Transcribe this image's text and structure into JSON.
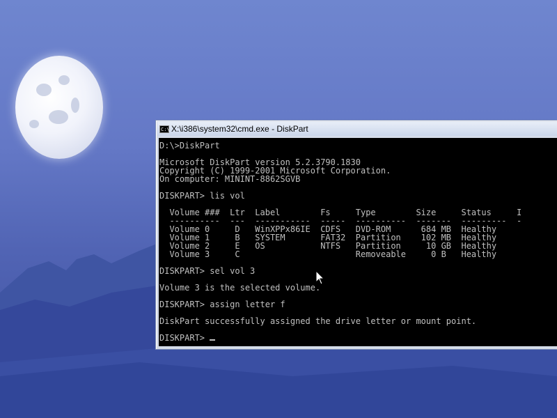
{
  "window": {
    "title": "X:\\i386\\system32\\cmd.exe - DiskPart",
    "icon": "cmd-icon"
  },
  "console": {
    "lines": [
      "D:\\>DiskPart",
      "",
      "Microsoft DiskPart version 5.2.3790.1830",
      "Copyright (C) 1999-2001 Microsoft Corporation.",
      "On computer: MININT-8862SGVB",
      "",
      "DISKPART> lis vol",
      "",
      "  Volume ###  Ltr  Label        Fs     Type        Size     Status     I",
      "  ----------  ---  -----------  -----  ----------  -------  ---------  -",
      "  Volume 0     D   WinXPPx86IE  CDFS   DVD-ROM      684 MB  Healthy",
      "  Volume 1     B   SYSTEM       FAT32  Partition    102 MB  Healthy",
      "  Volume 2     E   OS           NTFS   Partition     10 GB  Healthy",
      "  Volume 3     C                       Removeable     0 B   Healthy",
      "",
      "DISKPART> sel vol 3",
      "",
      "Volume 3 is the selected volume.",
      "",
      "DISKPART> assign letter f",
      "",
      "DiskPart successfully assigned the drive letter or mount point.",
      ""
    ],
    "prompt": "DISKPART> "
  }
}
